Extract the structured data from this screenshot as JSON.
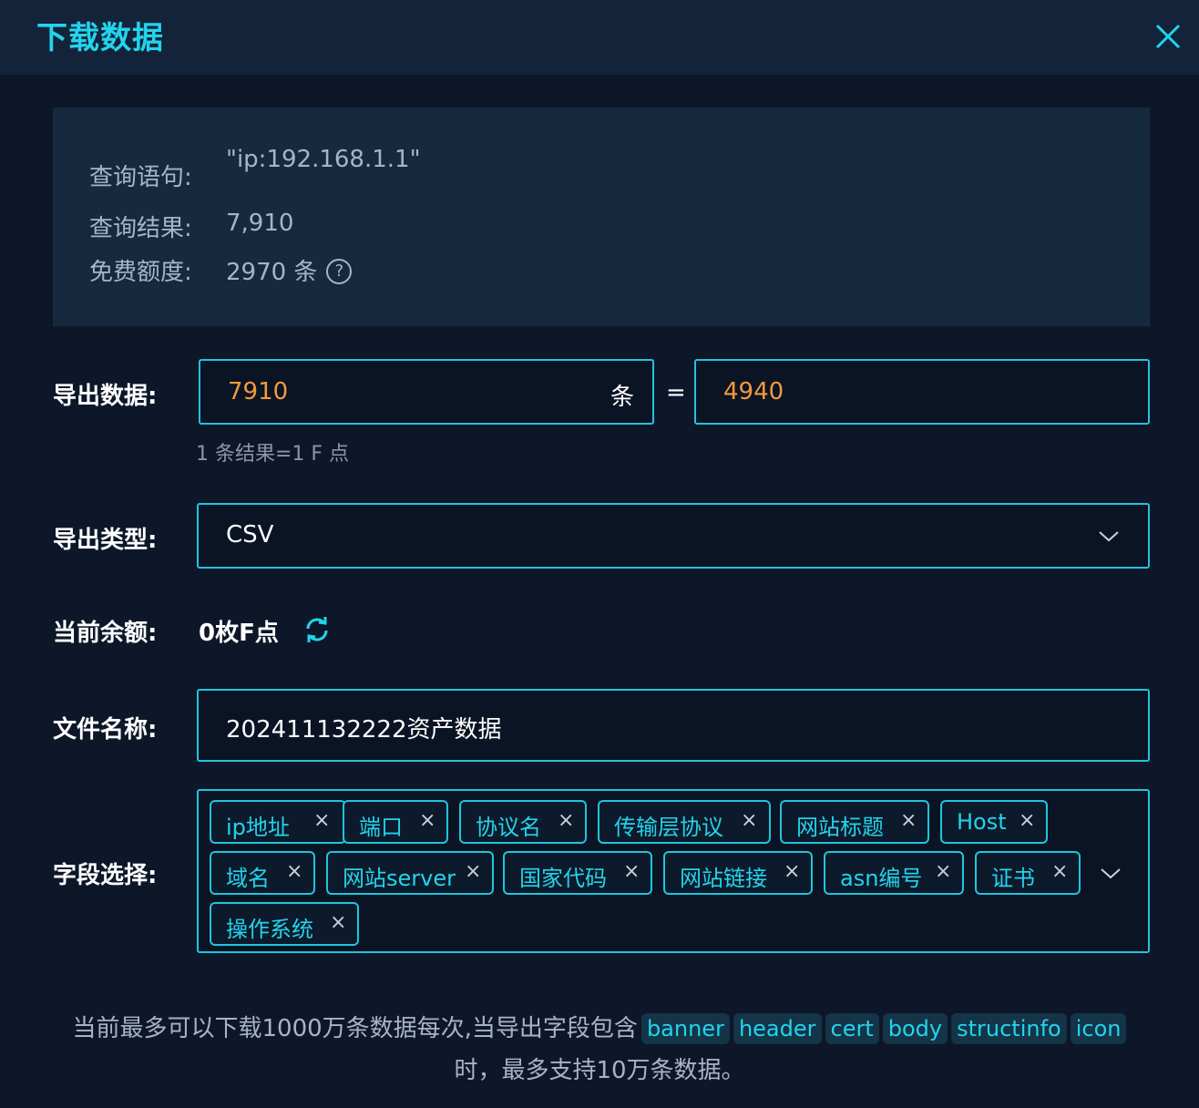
{
  "header": {
    "title": "下载数据"
  },
  "query_info": {
    "query_label": "查询语句:",
    "query_value": "\"ip:192.168.1.1\"",
    "result_label": "查询结果:",
    "result_value": "7,910",
    "quota_label": "免费额度:",
    "quota_value": "2970 条",
    "help_glyph": "?"
  },
  "export_count": {
    "label": "导出数据:",
    "count_value": "7910",
    "unit": "条",
    "equals": "=",
    "points_value": "4940",
    "hint": "1 条结果=1 F 点"
  },
  "export_type": {
    "label": "导出类型:",
    "selected": "CSV"
  },
  "balance": {
    "label": "当前余额:",
    "value": "0枚F点"
  },
  "file_name": {
    "label": "文件名称:",
    "value": "202411132222资产数据"
  },
  "fields": {
    "label": "字段选择:",
    "remove_glyph": "×",
    "tags": [
      "ip地址",
      "端口",
      "协议名",
      "传输层协议",
      "网站标题",
      "Host",
      "域名",
      "网站server",
      "国家代码",
      "网站链接",
      "asn编号",
      "证书",
      "操作系统"
    ]
  },
  "footer": {
    "line1_text": "当前最多可以下载1000万条数据每次,当导出字段包含",
    "keywords": [
      "banner",
      "header",
      "cert",
      "body",
      "structinfo",
      "icon"
    ],
    "line2_text": "时，最多支持10万条数据。"
  },
  "colors": {
    "accent": "#22d4ec",
    "border": "#1ec6dc",
    "highlight": "#f5993a",
    "background": "#0d1729"
  }
}
